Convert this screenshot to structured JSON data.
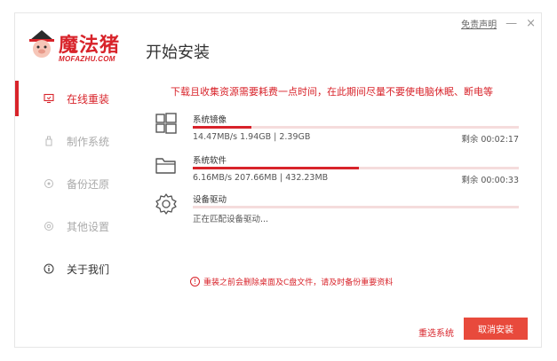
{
  "app": {
    "logo_text": "魔法猪",
    "logo_sub": "MOFAZHU.COM",
    "title": "开始安装",
    "disclaimer": "免责声明",
    "minimize": "—",
    "close": "×"
  },
  "sidebar": {
    "items": [
      {
        "label": "在线重装",
        "icon": "monitor-icon"
      },
      {
        "label": "制作系统",
        "icon": "usb-icon"
      },
      {
        "label": "备份还原",
        "icon": "restore-icon"
      },
      {
        "label": "其他设置",
        "icon": "settings-icon"
      },
      {
        "label": "关于我们",
        "icon": "info-icon"
      }
    ]
  },
  "notice": "下载且收集资源需要耗费一点时间，在此期间尽量不要使电脑休眠、断电等",
  "tasks": [
    {
      "name": "系统镜像",
      "stat": "14.47MB/s 1.94GB | 2.39GB",
      "remain": "剩余 00:02:17",
      "progress": 0.18,
      "icon": "windows-icon"
    },
    {
      "name": "系统软件",
      "stat": "6.16MB/s 207.66MB | 432.23MB",
      "remain": "剩余 00:00:33",
      "progress": 0.51,
      "icon": "folder-icon"
    },
    {
      "name": "设备驱动",
      "stat": "正在匹配设备驱动...",
      "remain": "",
      "progress": 0,
      "icon": "gear-icon"
    }
  ],
  "warning": "重装之前会删除桌面及C盘文件，请及时备份重要资料",
  "warning_icon": "!",
  "buttons": {
    "reselect": "重选系统",
    "cancel": "取消安装"
  },
  "colors": {
    "accent": "#d8232a",
    "button": "#e84a3c"
  }
}
